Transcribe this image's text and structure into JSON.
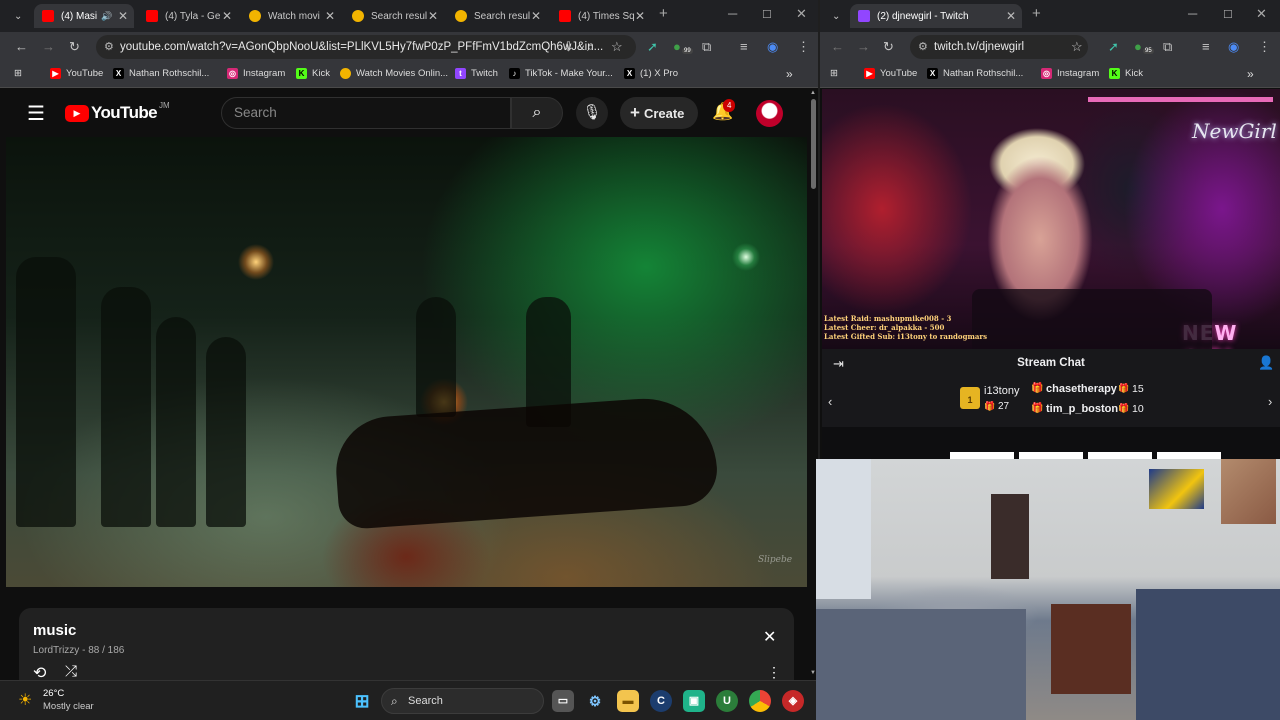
{
  "left_browser": {
    "tabs": [
      {
        "title": "(4) Masi",
        "favicon": "youtube"
      },
      {
        "title": "(4) Tyla - Ge",
        "favicon": "youtube"
      },
      {
        "title": "Watch movi",
        "favicon": "gold-circle"
      },
      {
        "title": "Search resul",
        "favicon": "gold-circle"
      },
      {
        "title": "Search resul",
        "favicon": "gold-circle"
      },
      {
        "title": "(4) Times Sq",
        "favicon": "youtube"
      }
    ],
    "url": "youtube.com/watch?v=AGonQbpNooU&list=PLlKVL5Hy7fwP0zP_PFfFmV1bdZcmQh6wJ&in...",
    "bookmarks": [
      "YouTube",
      "Nathan Rothschil...",
      "Instagram",
      "Kick",
      "Watch Movies Onlin...",
      "Twitch",
      "TikTok - Make Your...",
      "(1) X Pro"
    ],
    "extension_badge": "99"
  },
  "youtube": {
    "logo": "YouTube",
    "country_code": "JM",
    "search_placeholder": "Search",
    "create_label": "Create",
    "notification_count": "4",
    "playlist": {
      "title": "music",
      "meta": "LordTrizzy - 88 / 186"
    },
    "video_watermark": "Slipebe"
  },
  "right_browser": {
    "tab_title": "(2) djnewgirl - Twitch",
    "url": "twitch.tv/djnewgirl",
    "bookmarks": [
      "YouTube",
      "Nathan Rothschil...",
      "Instagram",
      "Kick"
    ],
    "extension_badge": "95"
  },
  "twitch": {
    "overlay_logo": "NewGirl",
    "overlay_banner": "NEW GIRL",
    "overlay_lines": [
      "Latest Raid: mashupmike008 - 3",
      "Latest Cheer: dr_alpakka - 500",
      "Latest Gifted Sub: i13tony to randogmars"
    ],
    "chat_title": "Stream Chat",
    "gifters": [
      {
        "name": "i13tony",
        "count": "27",
        "rank": "1"
      },
      {
        "name": "chasetherapy",
        "count": "15"
      },
      {
        "name": "tim_p_boston",
        "count": "10"
      }
    ]
  },
  "taskbar": {
    "temperature": "26°C",
    "weather": "Mostly clear",
    "search_label": "Search"
  }
}
